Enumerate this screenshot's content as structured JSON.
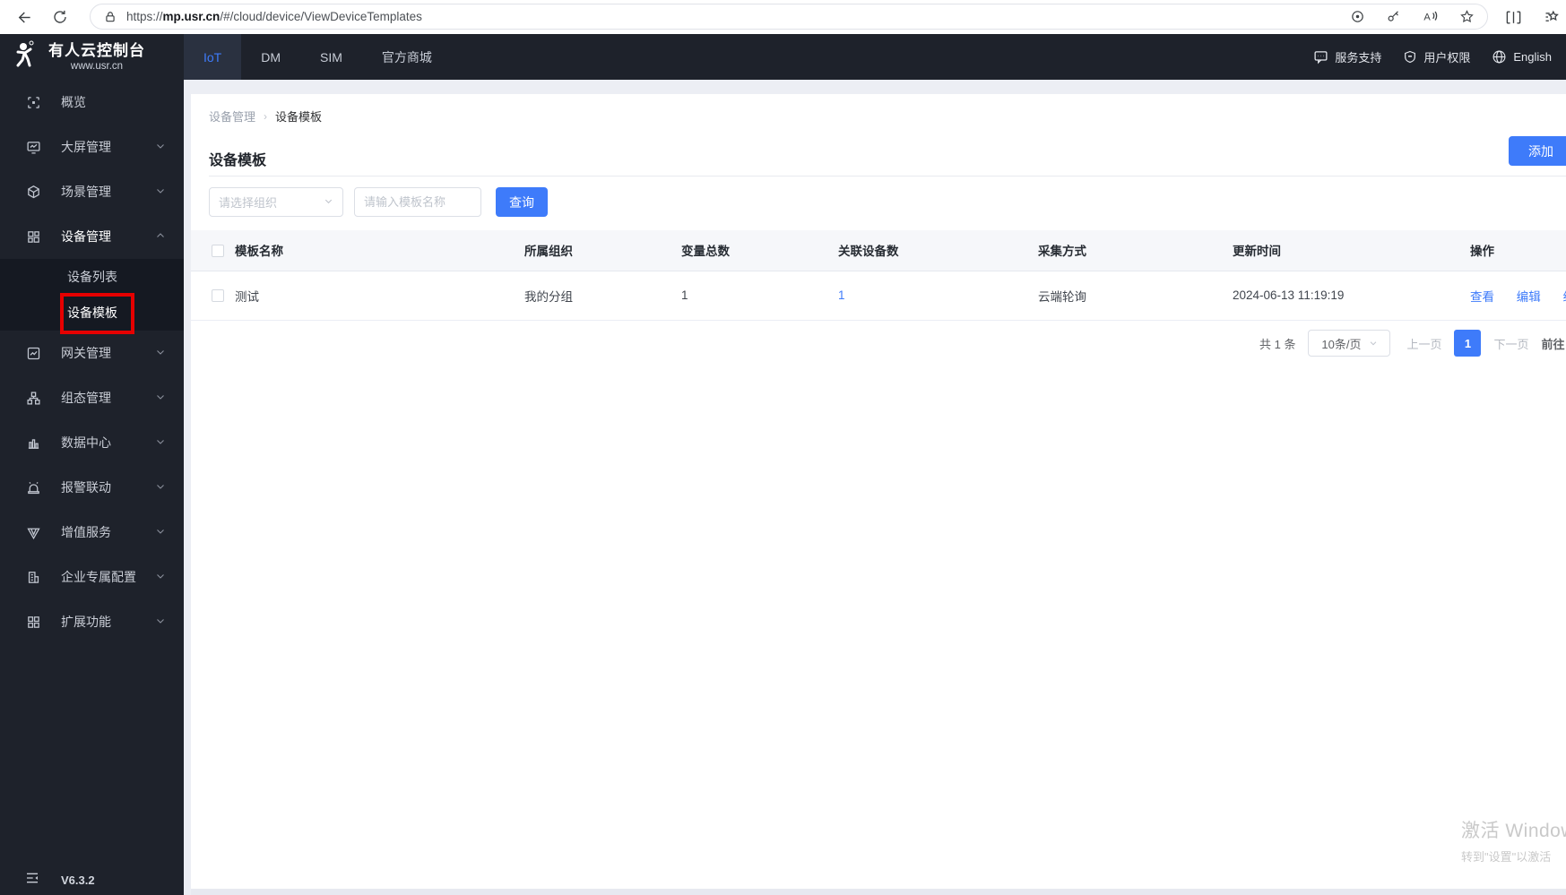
{
  "browser": {
    "url_scheme": "https://",
    "url_domain": "mp.usr.cn",
    "url_path": "/#/cloud/device/ViewDeviceTemplates"
  },
  "header": {
    "brand_title": "有人云控制台",
    "brand_subtitle": "www.usr.cn",
    "tabs": [
      {
        "label": "IoT"
      },
      {
        "label": "DM"
      },
      {
        "label": "SIM"
      },
      {
        "label": "官方商城"
      }
    ],
    "support_label": "服务支持",
    "permissions_label": "用户权限",
    "language_label": "English"
  },
  "sidebar": {
    "items": [
      {
        "label": "概览"
      },
      {
        "label": "大屏管理"
      },
      {
        "label": "场景管理"
      },
      {
        "label": "设备管理"
      },
      {
        "label": "网关管理"
      },
      {
        "label": "组态管理"
      },
      {
        "label": "数据中心"
      },
      {
        "label": "报警联动"
      },
      {
        "label": "增值服务"
      },
      {
        "label": "企业专属配置"
      },
      {
        "label": "扩展功能"
      }
    ],
    "submenu": [
      {
        "label": "设备列表"
      },
      {
        "label": "设备模板"
      }
    ],
    "version": "V6.3.2"
  },
  "page": {
    "breadcrumb": [
      "设备管理",
      "设备模板"
    ],
    "title": "设备模板",
    "add_button": "添加",
    "org_placeholder": "请选择组织",
    "name_placeholder": "请输入模板名称",
    "search_button": "查询"
  },
  "table": {
    "headers": [
      "模板名称",
      "所属组织",
      "变量总数",
      "关联设备数",
      "采集方式",
      "更新时间",
      "操作"
    ],
    "rows": [
      {
        "name": "测试",
        "org": "我的分组",
        "variables": "1",
        "devices": "1",
        "method": "云端轮询",
        "updated": "2024-06-13 11:19:19",
        "actions": [
          "查看",
          "编辑",
          "组"
        ]
      }
    ]
  },
  "pagination": {
    "total": "共 1 条",
    "page_size": "10条/页",
    "prev": "上一页",
    "current": "1",
    "next": "下一页",
    "goto": "前往"
  },
  "watermark": {
    "line1": "激活 Windows",
    "line2": "转到\"设置\"以激活"
  },
  "colors": {
    "accent": "#3e7bfa",
    "annotation": "#e60000",
    "header_dark": "#1e222b"
  }
}
